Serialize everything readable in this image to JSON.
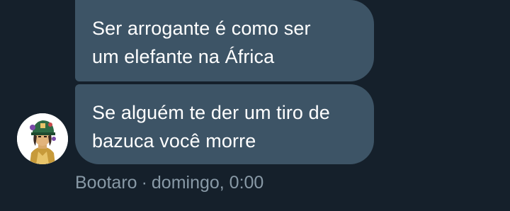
{
  "messages": [
    {
      "lines": [
        "Ser arrogante é como ser",
        "um elefante na África"
      ]
    },
    {
      "lines": [
        "Se alguém te der um tiro de",
        "bazuca você morre"
      ]
    }
  ],
  "sender": {
    "name": "Bootaro",
    "separator": "·",
    "timestamp": "domingo, 0:00",
    "avatar_icon": "jotaro-character-avatar"
  },
  "colors": {
    "background": "#15202b",
    "bubble": "#3d5466",
    "text": "#ffffff",
    "meta_text": "#8899a6"
  }
}
